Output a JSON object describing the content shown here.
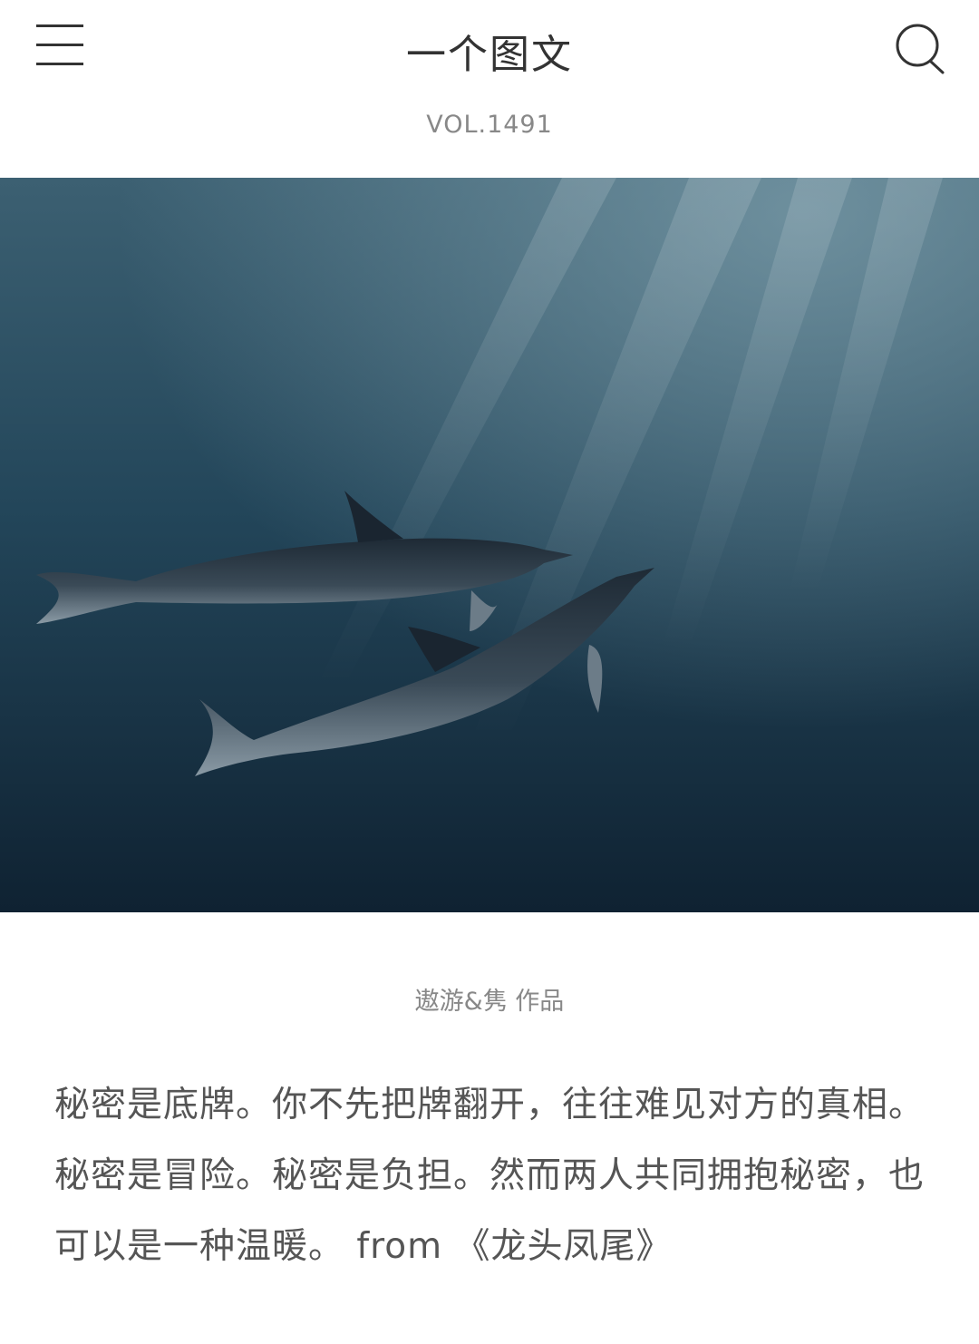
{
  "header": {
    "menu_icon": "hamburger-menu-icon",
    "title": "一个图文",
    "search_icon": "search-icon"
  },
  "volume": "VOL.1491",
  "photo": {
    "subject": "two dolphins swimming underwater",
    "colors": {
      "water_top": "#3c6072",
      "water_bottom": "#0f2232",
      "dolphin_dark": "#1e2a35",
      "dolphin_light": "#8a9aa5"
    }
  },
  "author_line": "遨游&隽 作品",
  "quote_text": "秘密是底牌。你不先把牌翻开，往往难见对方的真相。秘密是冒险。秘密是负担。然而两人共同拥抱秘密，也可以是一种温暖。 from 《龙头凤尾》"
}
